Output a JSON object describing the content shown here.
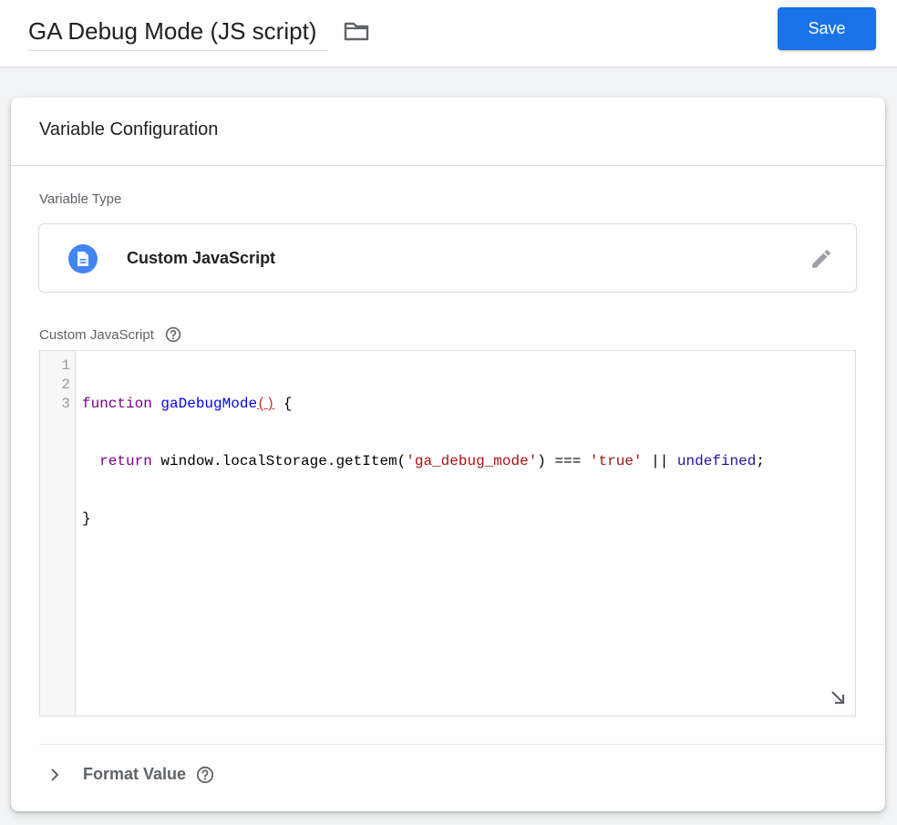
{
  "header": {
    "title": "GA Debug Mode (JS script)",
    "folder_icon": "folder-icon",
    "save_label": "Save"
  },
  "card": {
    "title": "Variable Configuration",
    "variable_type_label": "Variable Type",
    "variable_type": {
      "name": "Custom JavaScript",
      "icon": "document-icon",
      "edit_icon": "pencil-icon"
    },
    "js_label": "Custom JavaScript",
    "editor": {
      "line_numbers": [
        "1",
        "2",
        "3"
      ],
      "lines": [
        "function gaDebugMode() {",
        "  return window.localStorage.getItem('ga_debug_mode') === 'true' || undefined;",
        "}"
      ]
    },
    "format_value_label": "Format Value"
  },
  "colors": {
    "accent": "#1a73e8",
    "type_icon_bg": "#4285f4",
    "keyword": "#770088",
    "function_name": "#0000ff",
    "string": "#aa1111",
    "atom": "#221199"
  }
}
